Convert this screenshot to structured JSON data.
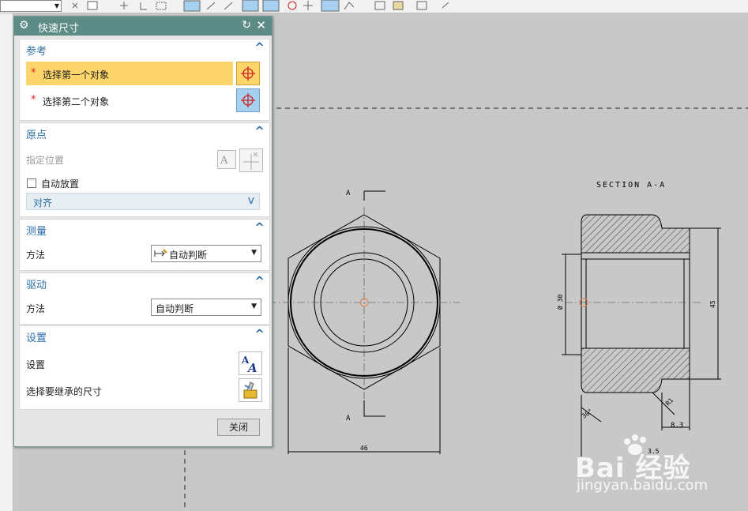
{
  "dialog": {
    "title": "快速尺寸",
    "reference": {
      "label": "参考",
      "first_object": "选择第一个对象",
      "second_object": "选择第二个对象"
    },
    "origin": {
      "label": "原点",
      "specify_location": "指定位置",
      "auto_place": "自动放置",
      "align": "对齐"
    },
    "measure": {
      "label": "测量",
      "method_label": "方法",
      "method_value": "自动判断"
    },
    "drive": {
      "label": "驱动",
      "method_label": "方法",
      "method_value": "自动判断"
    },
    "settings": {
      "label": "设置",
      "settings_label": "设置",
      "inherit_label": "选择要继承的尺寸"
    },
    "close_button": "关闭"
  },
  "drawing": {
    "section_title": "SECTION A-A",
    "cut_label_top": "A",
    "cut_label_bottom": "A",
    "dim_width": "46",
    "dim_bore": "Ø 30",
    "dim_height": "45",
    "dim_8_3": "8.3",
    "dim_30deg": "30°",
    "dim_r1": "R1",
    "dim_bottom": "3.5"
  },
  "watermark": {
    "brand": "Bai  经验",
    "url": "jingyan.baidu.com"
  },
  "colors": {
    "title_bar": "#5d8b85",
    "active_select": "#fdd56a",
    "select_blue": "#a6d0ef",
    "group_label": "#2f6fa8",
    "canvas": "#c8c8c8"
  }
}
